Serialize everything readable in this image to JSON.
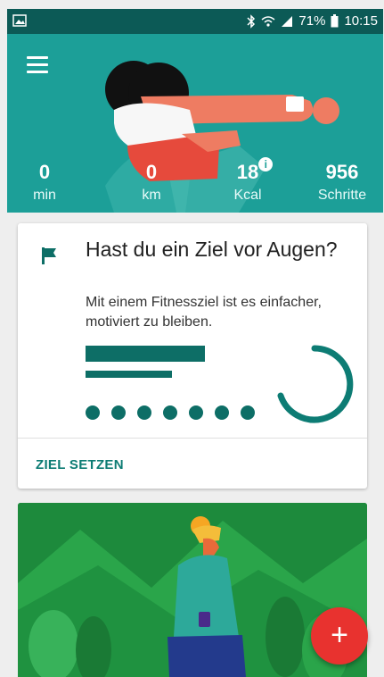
{
  "status_bar": {
    "battery": "71%",
    "time": "10:15",
    "icons": [
      "gallery-icon",
      "bluetooth-icon",
      "wifi-icon",
      "signal-icon",
      "battery-icon"
    ]
  },
  "header": {
    "stats": [
      {
        "value": "0",
        "label": "min"
      },
      {
        "value": "0",
        "label": "km"
      },
      {
        "value": "18",
        "label": "Kcal"
      },
      {
        "value": "956",
        "label": "Schritte"
      }
    ]
  },
  "goal_card": {
    "title": "Hast du ein Ziel vor Augen?",
    "text": "Mit einem Fitnessziel ist es einfacher, motiviert zu bleiben.",
    "action": "ZIEL SETZEN",
    "dot_count": 7
  },
  "fab": {
    "icon": "plus-icon",
    "label": "+"
  },
  "colors": {
    "header": "#1c9f98",
    "status_bar": "#0c5a56",
    "accent": "#0d6e66",
    "fab": "#e8322f",
    "card2": "#1d8a3c"
  }
}
